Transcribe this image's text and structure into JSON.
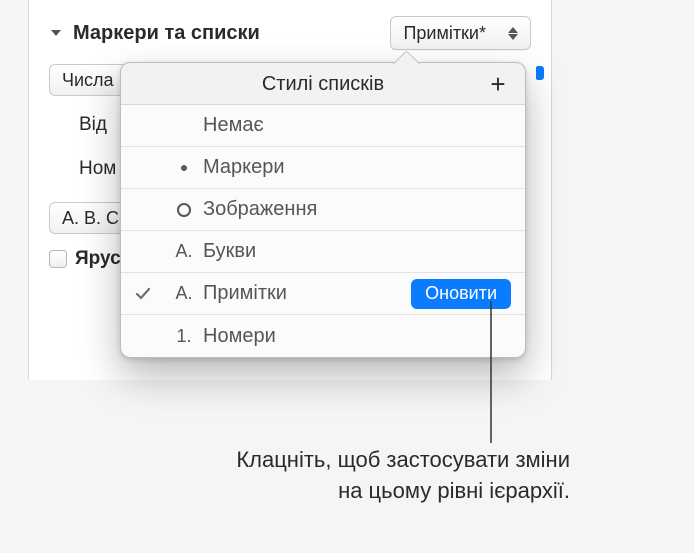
{
  "section": {
    "title": "Маркери та списки",
    "style_dropdown": "Примітки*",
    "numbers_dropdown": "Числа",
    "indent_label": "Від",
    "number_label": "Ном",
    "abc_dropdown": "A. B. C.",
    "tier_checkbox": "Ярус"
  },
  "popover": {
    "title": "Стилі списків",
    "items": [
      {
        "marker": "none",
        "label": "Немає"
      },
      {
        "marker": "dot",
        "label": "Маркери"
      },
      {
        "marker": "circle",
        "label": "Зображення"
      },
      {
        "marker": "A.",
        "label": "Букви"
      },
      {
        "marker": "A.",
        "label": "Примітки",
        "selected": true,
        "update": true
      },
      {
        "marker": "1.",
        "label": "Номери"
      }
    ],
    "update_label": "Оновити"
  },
  "callout": {
    "line1": "Клацніть, щоб застосувати зміни",
    "line2": "на цьому рівні ієрархії."
  }
}
